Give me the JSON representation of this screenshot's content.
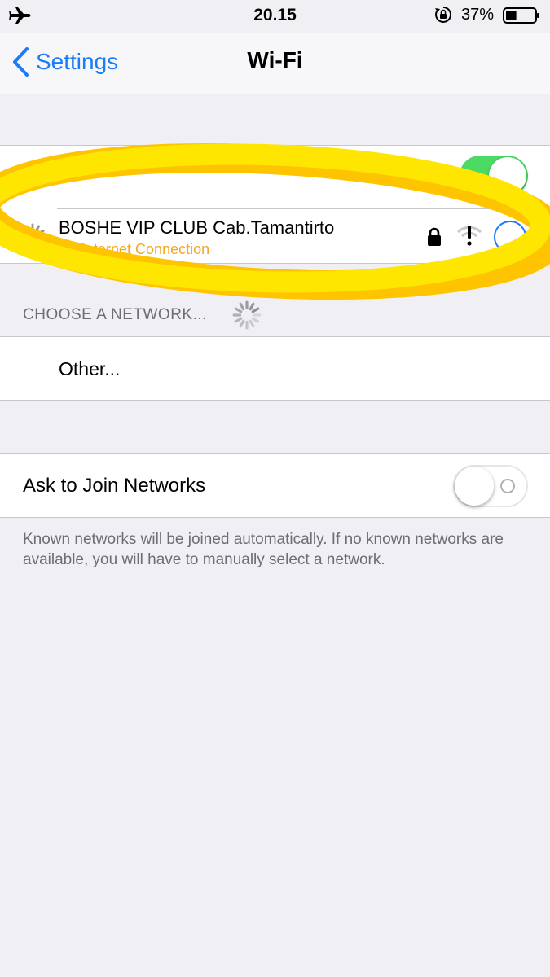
{
  "status_bar": {
    "time": "20.15",
    "battery_percent": "37%",
    "battery_level": 0.37,
    "icons": [
      "airplane-icon",
      "rotation-lock-icon",
      "battery-icon"
    ]
  },
  "nav": {
    "back_label": "Settings",
    "title": "Wi-Fi"
  },
  "wifi": {
    "enabled": true,
    "connected_network": {
      "name": "BOSHE VIP CLUB Cab.Tamantirto",
      "status": "No Internet Connection"
    }
  },
  "choose_network": {
    "header": "CHOOSE A NETWORK...",
    "other_label": "Other..."
  },
  "ask_to_join": {
    "label": "Ask to Join Networks",
    "enabled": false,
    "footnote": "Known networks will be joined automatically. If no known networks are available, you will have to manually select a network."
  },
  "colors": {
    "accent": "#1a7cf6",
    "toggle_on": "#4cd964",
    "warning_text": "#f5a623",
    "highlight": "#ffe600",
    "background": "#efeff4"
  }
}
